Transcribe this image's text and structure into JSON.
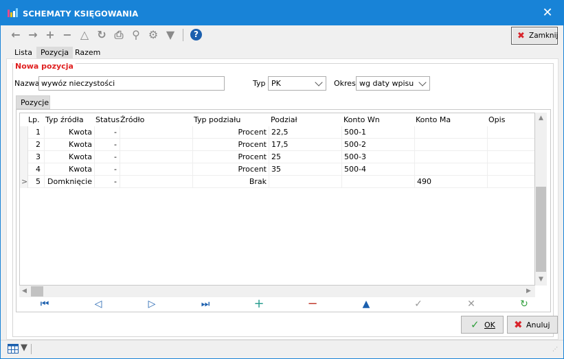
{
  "window": {
    "title": "SCHEMATY KSIĘGOWANIA",
    "close_glyph": "✕"
  },
  "toolbar": {
    "icons": [
      "arrow-left-icon",
      "arrow-right-icon",
      "plus-icon",
      "minus-icon",
      "triangle-icon",
      "refresh-icon",
      "print-icon",
      "zoom-icon",
      "gears-icon",
      "filter-icon",
      "help-icon"
    ],
    "close_label": "Zamknij"
  },
  "tabs": [
    "Lista",
    "Pozycja",
    "Razem"
  ],
  "form": {
    "group_title": "Nowa pozycja",
    "nazwa_label": "Nazwa",
    "nazwa_value": "wywóz nieczystości",
    "typ_label": "Typ",
    "typ_value": "PK",
    "okres_label": "Okres",
    "okres_value": "wg daty wpisu"
  },
  "subtab": "Pozycje",
  "grid": {
    "columns": [
      "Lp.",
      "Typ źródła",
      "Status",
      "Źródło",
      "Typ podziału",
      "Podział",
      "Konto Wn",
      "Konto Ma",
      "Opis"
    ],
    "rows": [
      {
        "lp": "1",
        "typ": "Kwota",
        "status": "-",
        "zrodlo": "",
        "typ_podzialu": "Procent",
        "podzial": "22,5",
        "wn": "500-1",
        "ma": "",
        "opis": ""
      },
      {
        "lp": "2",
        "typ": "Kwota",
        "status": "-",
        "zrodlo": "",
        "typ_podzialu": "Procent",
        "podzial": "17,5",
        "wn": "500-2",
        "ma": "",
        "opis": ""
      },
      {
        "lp": "3",
        "typ": "Kwota",
        "status": "-",
        "zrodlo": "",
        "typ_podzialu": "Procent",
        "podzial": "25",
        "wn": "500-3",
        "ma": "",
        "opis": ""
      },
      {
        "lp": "4",
        "typ": "Kwota",
        "status": "-",
        "zrodlo": "",
        "typ_podzialu": "Procent",
        "podzial": "35",
        "wn": "500-4",
        "ma": "",
        "opis": ""
      },
      {
        "lp": "5",
        "typ": "Domknięcie",
        "status": "-",
        "zrodlo": "",
        "typ_podzialu": "Brak",
        "podzial": "",
        "wn": "",
        "ma": "490",
        "opis": ""
      }
    ],
    "current_row_marker": ">"
  },
  "navigator": {
    "buttons": [
      "first-icon",
      "prev-icon",
      "next-icon",
      "last-icon",
      "add-icon",
      "remove-icon",
      "edit-icon",
      "accept-icon",
      "cancel-icon",
      "refresh-icon"
    ]
  },
  "buttons": {
    "ok_label": "OK",
    "anuluj_label": "Anuluj"
  },
  "colors": {
    "titlebar": "#1883d7",
    "group_title": "#e02020",
    "nav_teal": "#2a9d8f",
    "ok_green": "#2e9e3a",
    "cancel_red": "#d8232a"
  }
}
